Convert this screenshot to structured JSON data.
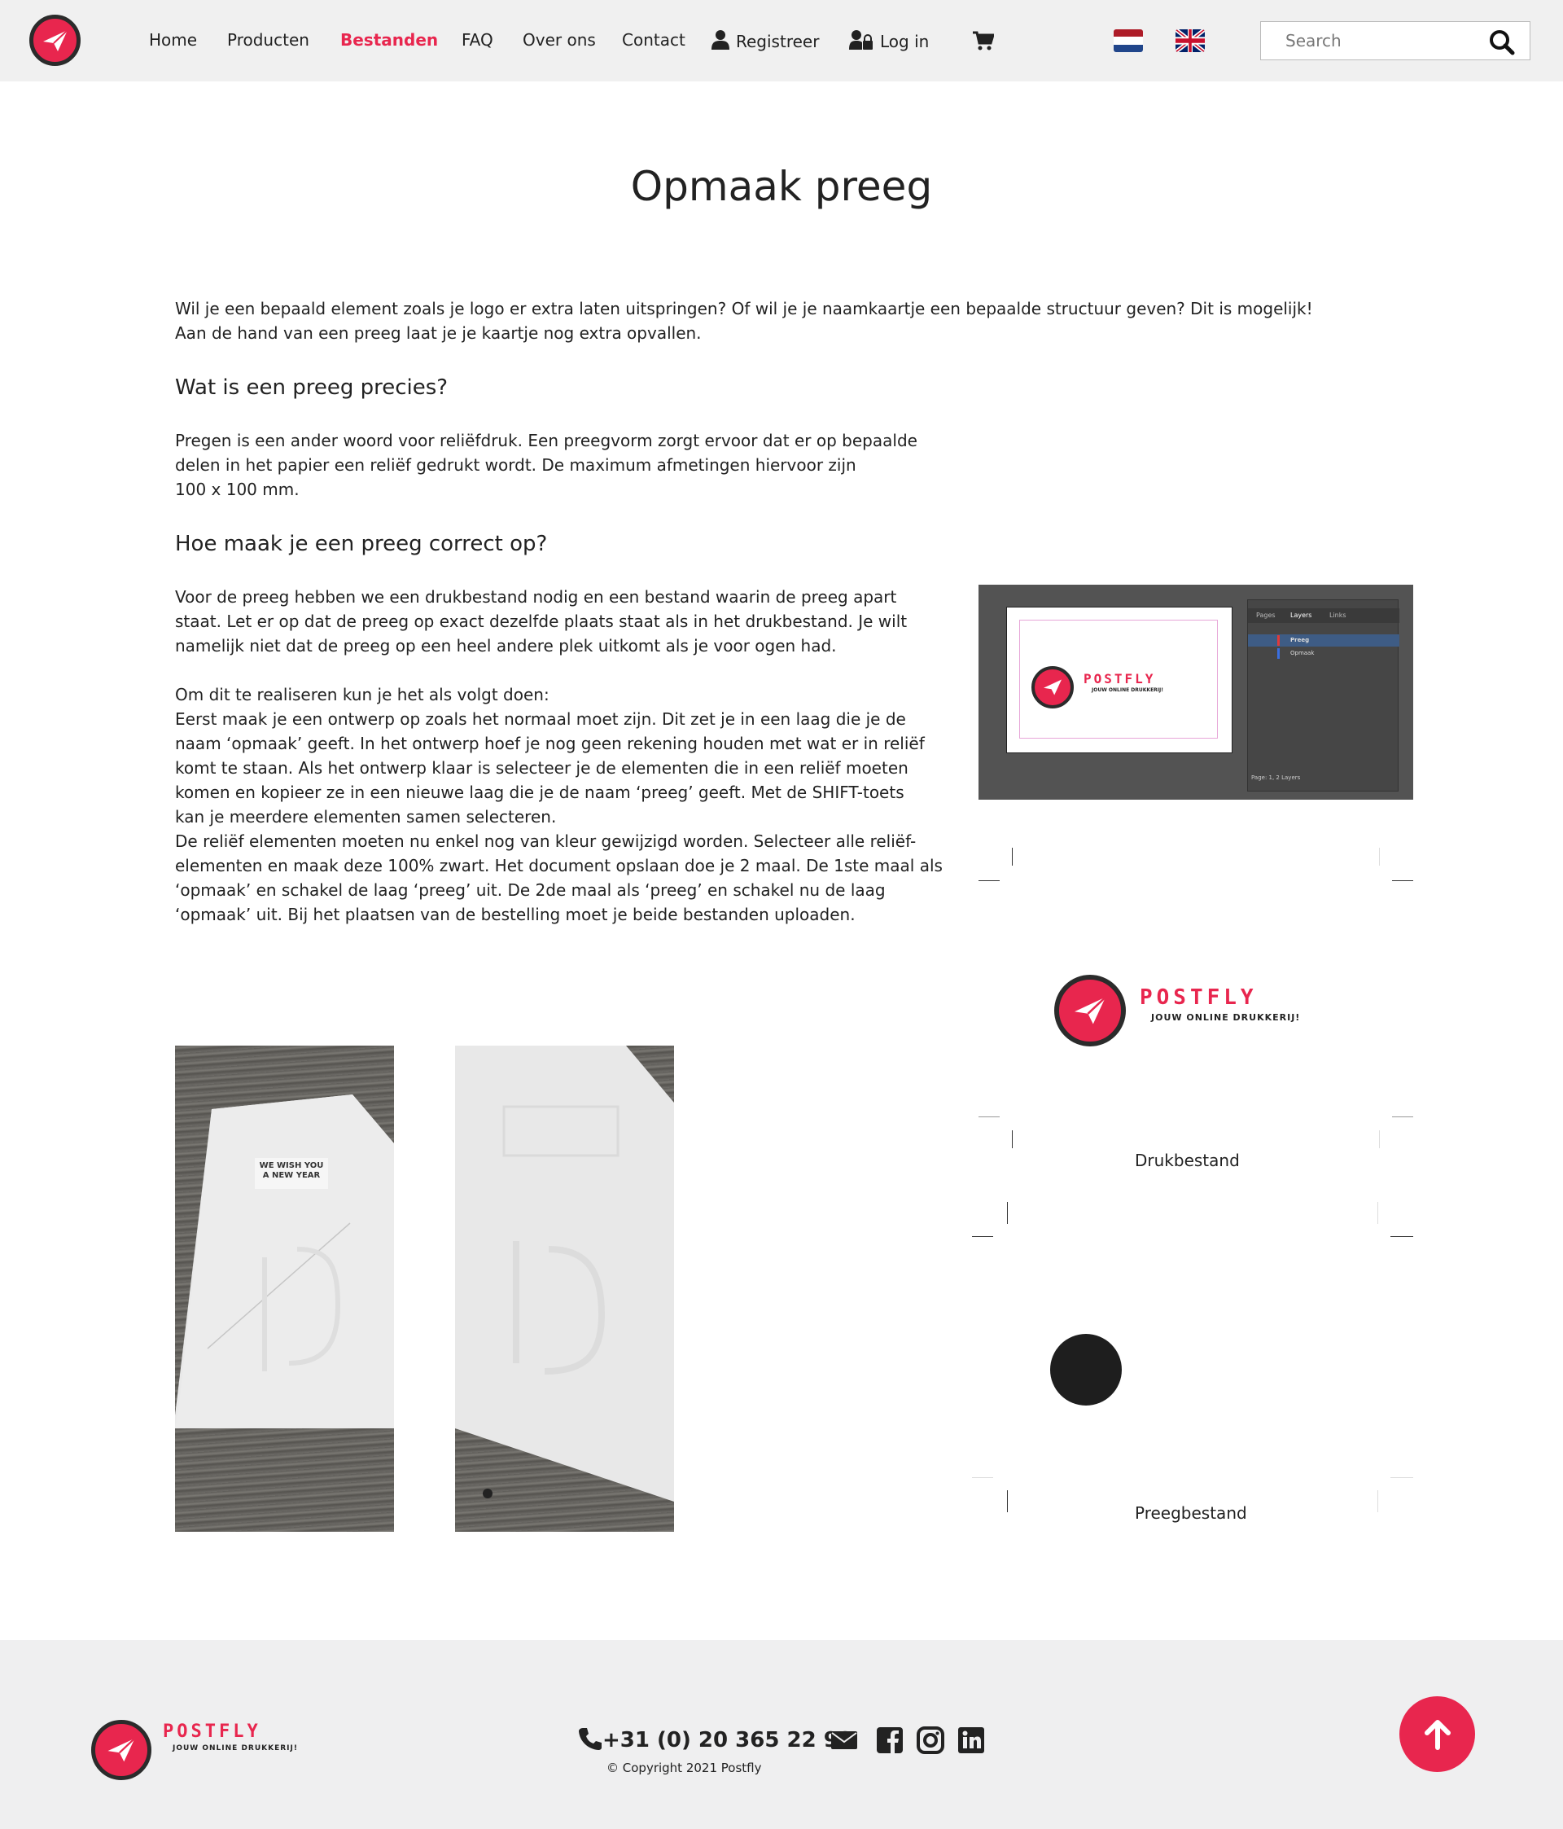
{
  "nav": {
    "items": [
      {
        "label": "Home"
      },
      {
        "label": "Producten"
      },
      {
        "label": "Bestanden"
      },
      {
        "label": "FAQ"
      },
      {
        "label": "Over ons"
      },
      {
        "label": "Contact"
      },
      {
        "label": "Registreer"
      },
      {
        "label": "Log in"
      }
    ],
    "active": "Bestanden",
    "search_placeholder": "Search"
  },
  "page": {
    "title": "Opmaak preeg",
    "intro_1": "Wil je een bepaald element zoals je logo er extra laten uitspringen? Of wil je je naamkaartje een bepaalde structuur geven? Dit is mogelijk!",
    "intro_2": "Aan de hand van een preeg laat je je kaartje nog extra opvallen.",
    "h_what": "Wat is een preeg precies?",
    "what_1": "Pregen is een ander woord voor reliëfdruk. Een preegvorm zorgt ervoor dat er op bepaalde",
    "what_2": "delen in het papier een reliëf gedrukt wordt. De maximum afmetingen hiervoor zijn",
    "what_3": "100 x 100 mm.",
    "h_how": "Hoe maak je een preeg correct op?",
    "how_lines": [
      "Voor de preeg hebben we een drukbestand nodig en een bestand waarin de preeg apart",
      "staat. Let er op dat de preeg op exact dezelfde plaats staat als in het drukbestand. Je wilt",
      "namelijk niet dat de preeg op een heel andere plek uitkomt als je voor ogen had.",
      "",
      "Om dit te realiseren kun je het als volgt doen:",
      "Eerst maak je een ontwerp op zoals het normaal moet zijn. Dit zet je in een laag die je de",
      "naam ‘opmaak’ geeft. In het ontwerp hoef je nog geen rekening houden met wat er in reliëf",
      "komt te staan. Als het ontwerp klaar is selecteer je de elementen die in een reliëf moeten",
      "komen en kopieer ze in een nieuwe laag die je de naam ‘preeg’ geeft. Met de SHIFT-toets",
      "kan je meerdere elementen samen selecteren.",
      "De reliëf elementen moeten nu enkel nog van kleur gewijzigd worden. Selecteer alle reliëf-",
      "elementen en maak deze 100% zwart. Het document opslaan doe je 2 maal. De 1ste maal als",
      "‘opmaak’ en schakel de laag ‘preeg’ uit. De 2de maal als ‘preeg’ en schakel nu de laag",
      "‘opmaak’ uit. Bij het plaatsen van de bestelling moet je beide bestanden uploaden."
    ],
    "caption_print": "Drukbestand",
    "caption_emboss": "Preegbestand"
  },
  "screenshot_panel": {
    "tabs": [
      "Pages",
      "Layers",
      "Links"
    ],
    "layers": [
      "Preeg",
      "Opmaak"
    ],
    "status": "Page: 1, 2 Layers"
  },
  "card_photo": {
    "text_1": "WE WISH YOU",
    "text_2": "A NEW YEAR"
  },
  "brand": {
    "name": "POSTFLY",
    "tagline": "JOUW ONLINE DRUKKERIJ!"
  },
  "footer": {
    "phone": "+31 (0) 20 365 22 93",
    "copyright": "© Copyright 2021 Postfly"
  },
  "colors": {
    "accent": "#e8264e",
    "dark": "#222222",
    "header_bg": "#f0f0f0",
    "footer_bg": "#efeff0"
  },
  "icons": [
    "paper-plane-icon",
    "user-icon",
    "user-lock-icon",
    "cart-icon",
    "flag-nl-icon",
    "flag-uk-icon",
    "search-icon",
    "phone-icon",
    "envelope-icon",
    "facebook-icon",
    "instagram-icon",
    "linkedin-icon",
    "arrow-up-icon"
  ]
}
